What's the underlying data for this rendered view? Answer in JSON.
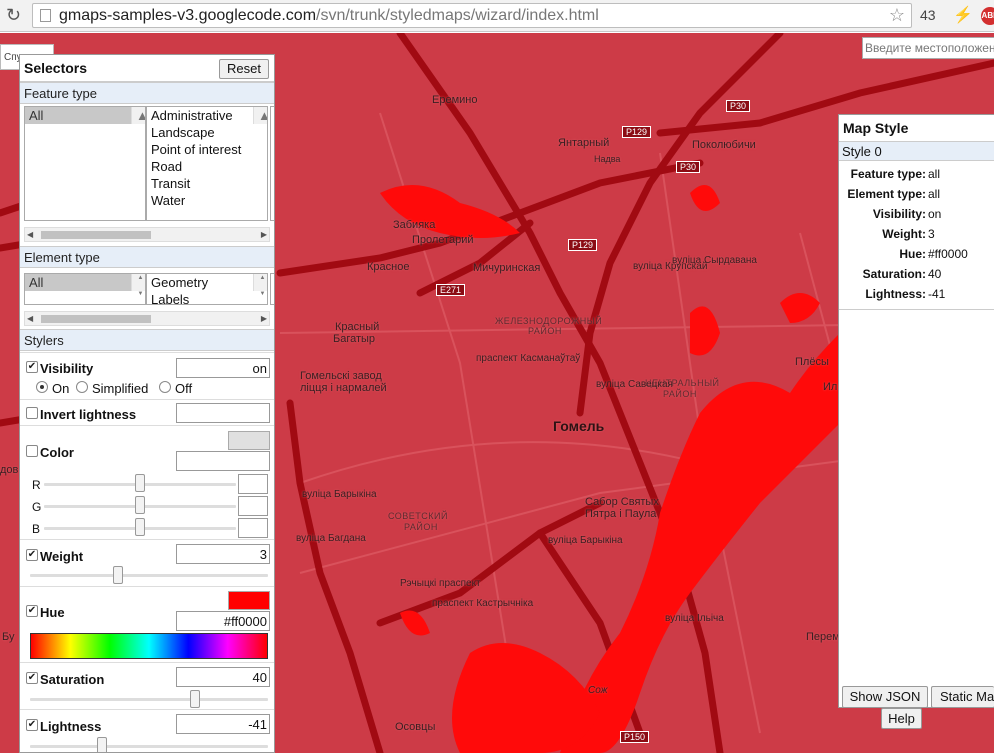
{
  "browser": {
    "url_host": "gmaps-samples-v3.googlecode.com",
    "url_path": "/svn/trunk/styledmaps/wizard/index.html",
    "tab_count": "43",
    "adblock_badge": "ABP"
  },
  "map": {
    "search_placeholder": "Введите местоположение",
    "left_control_label": "Спутник",
    "labels": {
      "eremino": "Еремино",
      "yantarny": "Янтарный",
      "pokolyubichi": "Поколюбичи",
      "zabiyaka": "Забияка",
      "proletary": "Пролетарий",
      "krasnoe": "Красное",
      "michurinskaya": "Мичуринская",
      "krasny_bogatyr_1": "Красный",
      "krasny_bogatyr_2": "Багатыр",
      "zheleznodorozhny_1": "ЖЕЛЕЗНОДОРОЖНЫЙ",
      "zheleznodorozhny_2": "РАЙОН",
      "gomel_zavod_1": "Гомельскі завод",
      "gomel_zavod_2": "ліцця і нармалей",
      "tsentralny_1": "ЦЕНТРАЛЬНЫЙ",
      "tsentralny_2": "РАЙОН",
      "gomel": "Гомель",
      "sovetsky_1": "СОВЕТСКИЙ",
      "sovetsky_2": "РАЙОН",
      "sabor_1": "Сабор Святых",
      "sabor_2": "Пятра і Паула",
      "plyosy": "Плёсы",
      "osovtsy": "Осовцы",
      "peremo": "Перем",
      "il": "Ил",
      "dov": "дов",
      "bu": "Бу",
      "nadva": "Надва",
      "street_barykina_1": "вуліца Барыкіна",
      "street_barykina_2": "вуліца Барыкіна",
      "street_savetskaya": "вуліца Савецкая",
      "street_rechitsky": "Рэчыцкі праспект",
      "street_kastrychnika": "праспект Кастрычніка",
      "street_kasmanaytau": "праспект Касманаўтаў",
      "street_krupskaj": "вуліца Крупскай",
      "street_syrdavana": "вуліца Сырдавана",
      "street_ilicha": "вуліца Ільіча",
      "street_bahdana": "вуліца Багдана",
      "sozh": "Сож"
    },
    "road_shields": {
      "p30a": "P30",
      "p30b": "P30",
      "p129a": "P129",
      "p129b": "P129",
      "e271": "E271",
      "p150": "P150"
    }
  },
  "selectors": {
    "title": "Selectors",
    "reset_label": "Reset",
    "feature_type_header": "Feature type",
    "feature_types": [
      "All",
      "Administrative",
      "Landscape",
      "Point of interest",
      "Road",
      "Transit",
      "Water"
    ],
    "element_type_header": "Element type",
    "element_types": [
      "All",
      "Geometry",
      "Labels"
    ],
    "stylers_header": "Stylers",
    "visibility": {
      "label": "Visibility",
      "checked": true,
      "value": "on",
      "options": [
        "On",
        "Simplified",
        "Off"
      ],
      "selected": "On"
    },
    "invert": {
      "label": "Invert lightness",
      "checked": false,
      "value": ""
    },
    "color": {
      "label": "Color",
      "checked": false,
      "value": "",
      "r_label": "R",
      "g_label": "G",
      "b_label": "B",
      "r": "",
      "g": "",
      "b": ""
    },
    "weight": {
      "label": "Weight",
      "checked": true,
      "value": "3"
    },
    "hue": {
      "label": "Hue",
      "checked": true,
      "value": "#ff0000",
      "swatch_color": "#ff0000"
    },
    "saturation": {
      "label": "Saturation",
      "checked": true,
      "value": "40"
    },
    "lightness": {
      "label": "Lightness",
      "checked": true,
      "value": "-41"
    }
  },
  "map_style": {
    "title": "Map Style",
    "style_name": "Style 0",
    "rows": [
      {
        "key": "Feature type:",
        "value": "all"
      },
      {
        "key": "Element type:",
        "value": "all"
      },
      {
        "key": "Visibility:",
        "value": "on"
      },
      {
        "key": "Weight:",
        "value": "3"
      },
      {
        "key": "Hue:",
        "value": "#ff0000"
      },
      {
        "key": "Saturation:",
        "value": "40"
      },
      {
        "key": "Lightness:",
        "value": "-41"
      }
    ],
    "show_json": "Show JSON",
    "static_map": "Static Map",
    "help": "Help"
  },
  "colors": {
    "map_bg": "#cd3b47",
    "water": "#ff0a0a",
    "road": "#a10a12",
    "panel_header": "#e6eef8"
  }
}
